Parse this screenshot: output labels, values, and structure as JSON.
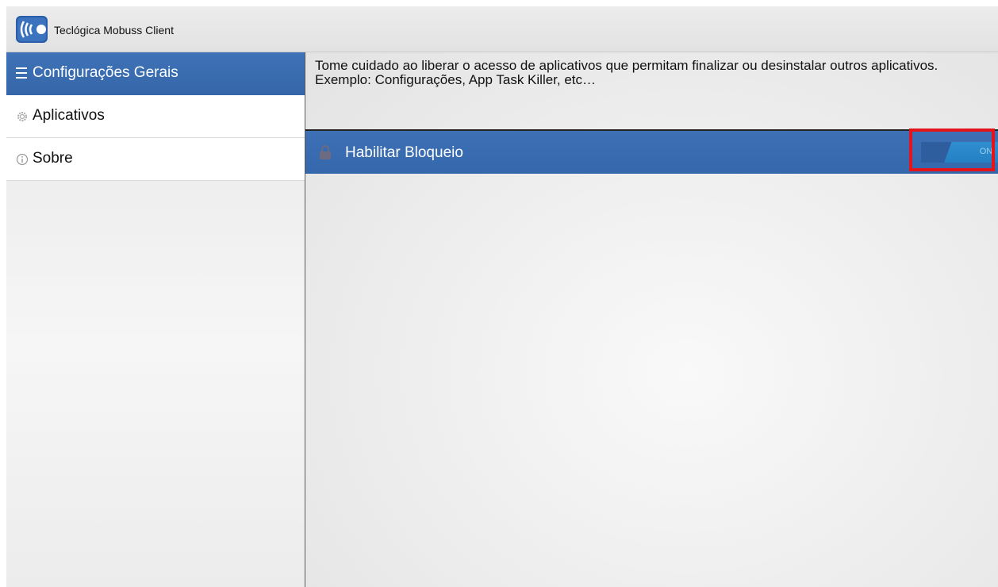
{
  "app": {
    "title": "Teclógica Mobuss Client",
    "logo_icon": "mobuss-signal-logo-icon"
  },
  "sidebar": {
    "header": {
      "label": "Configurações Gerais",
      "icon": "menu-lines-icon"
    },
    "items": [
      {
        "label": "Aplicativos",
        "icon": "gear-icon"
      },
      {
        "label": "Sobre",
        "icon": "info-icon"
      }
    ]
  },
  "main": {
    "warning": "Tome cuidado ao liberar o acesso de aplicativos que permitam finalizar ou desinstalar outros aplicativos.\nExemplo: Configurações, App Task Killer, etc…",
    "setting": {
      "label": "Habilitar Bloqueio",
      "icon": "lock-icon",
      "switch_text": "ON",
      "enabled": true
    }
  },
  "colors": {
    "header_blue": "#3a6db2",
    "switch_on": "#2a88c9",
    "highlight": "#e3141a"
  }
}
